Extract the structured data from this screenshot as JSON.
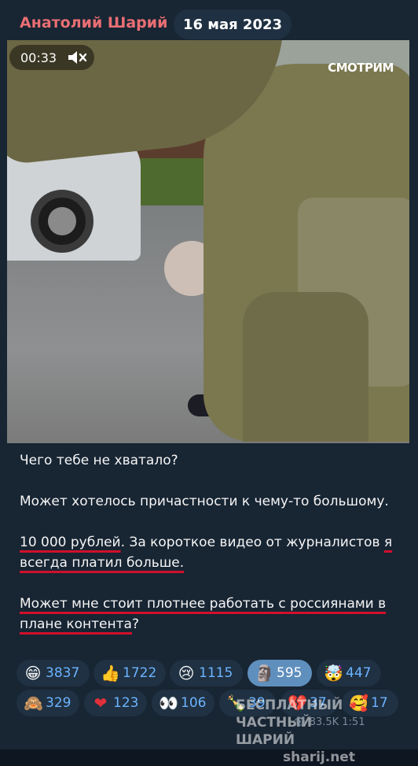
{
  "header": {
    "author": "Анатолий Шарий",
    "date": "16 мая 2023"
  },
  "video": {
    "duration": "00:33",
    "watermark": "СМОТРИМ"
  },
  "message": {
    "p1": "Чего тебе не хватало?",
    "p2": "Может хотелось причастности к чему-то большому.",
    "p3a": "10 000 рублей",
    "p3b": ". За короткое видео от журналистов ",
    "p3c": "я всегда платил больше.",
    "p4a": "Может мне стоит плотнее работать с россиянами в плане контента",
    "p4b": "?"
  },
  "reactions": {
    "row1": [
      {
        "icon": "grinning-face-icon",
        "glyph": "😁",
        "count": "3837",
        "selected": false
      },
      {
        "icon": "thumbs-up-icon",
        "glyph": "👍",
        "count": "1722",
        "selected": false
      },
      {
        "icon": "crying-face-icon",
        "glyph": "😢",
        "count": "1115",
        "selected": false
      },
      {
        "icon": "moai-icon",
        "glyph": "🗿",
        "count": "595",
        "selected": true
      },
      {
        "icon": "exploding-head-icon",
        "glyph": "🤯",
        "count": "447",
        "selected": false
      }
    ],
    "row2": [
      {
        "icon": "see-no-evil-monkey-icon",
        "glyph": "🙈",
        "count": "329",
        "selected": false
      },
      {
        "icon": "red-heart-icon",
        "glyph": "❤",
        "count": "123",
        "selected": false
      },
      {
        "icon": "eyes-icon",
        "glyph": "👀",
        "count": "106",
        "selected": false
      },
      {
        "icon": "champagne-icon",
        "glyph": "🍾",
        "count": "39",
        "selected": false
      },
      {
        "icon": "broken-heart-icon",
        "glyph": "💔",
        "count": "37",
        "selected": false
      },
      {
        "icon": "smiling-hearts-face-icon",
        "glyph": "🥰",
        "count": "17",
        "selected": false
      }
    ]
  },
  "footer": {
    "watermark_line1": "БЕСПЛАТНЫЙ ЧАСТНЫЙ",
    "watermark_line2": "ШАРИЙ",
    "watermark_site": "sharij.net",
    "views": "83.5K",
    "time": "1:51"
  },
  "colors": {
    "author": "#e96f73",
    "background": "#182533",
    "reaction_chip": "#1f3142",
    "reaction_selected": "#5f8fbd",
    "reaction_count": "#6cb3ff",
    "underline": "#d0102c"
  }
}
